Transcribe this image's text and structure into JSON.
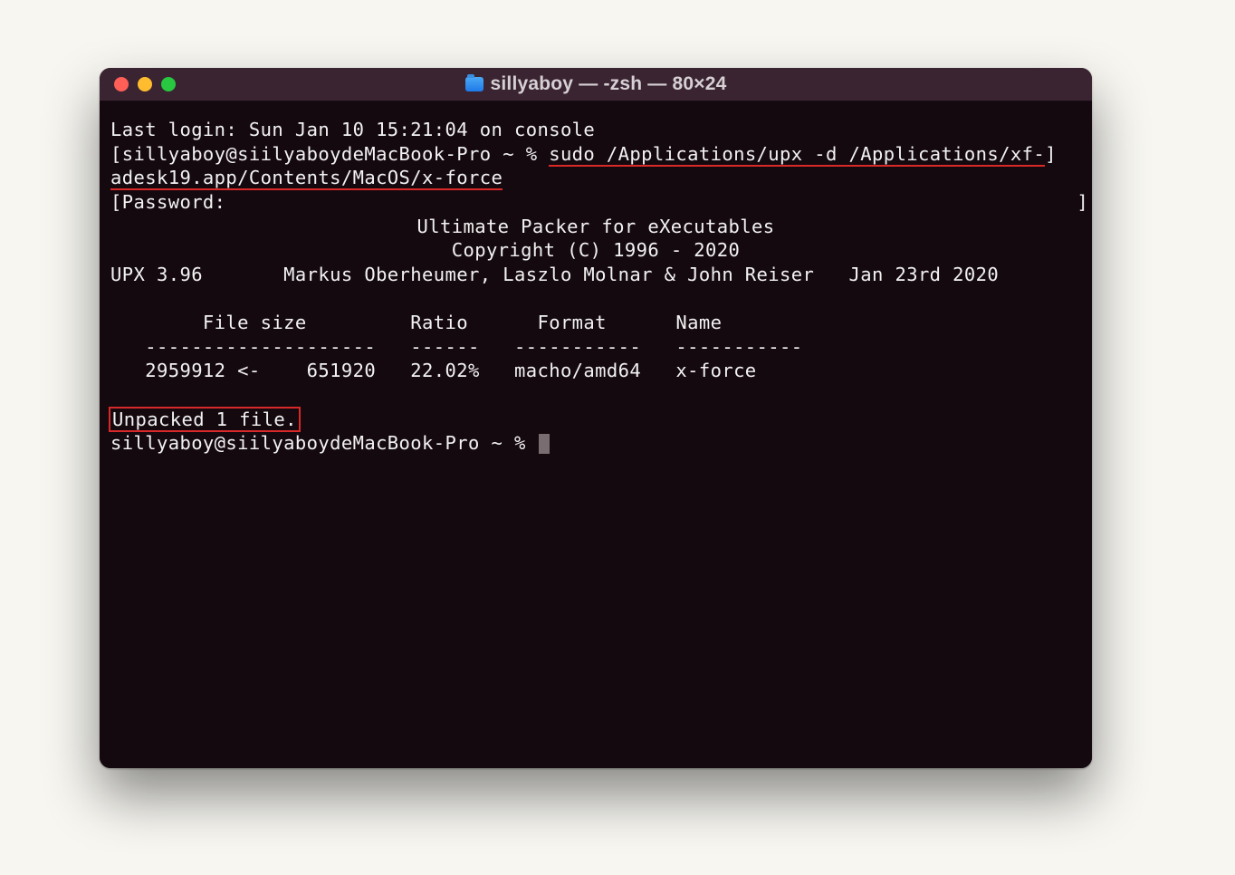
{
  "window": {
    "title": "sillyaboy — -zsh — 80×24"
  },
  "term": {
    "last_login": "Last login: Sun Jan 10 15:21:04 on console",
    "prompt1_prefix": "[sillyaboy@siilyaboydeMacBook-Pro ~ % ",
    "cmd_line1": "sudo /Applications/upx -d /Applications/xf-",
    "prompt1_suffix": "]",
    "cmd_line2": "adesk19.app/Contents/MacOS/x-force",
    "password_prefix": "[Password:",
    "password_suffix": "]",
    "upx_title": "Ultimate Packer for eXecutables",
    "upx_copyright": "Copyright (C) 1996 - 2020",
    "upx_ver_line": "UPX 3.96       Markus Oberheumer, Laszlo Molnar & John Reiser   Jan 23rd 2020",
    "tbl_head": "        File size         Ratio      Format      Name",
    "tbl_rule": "   --------------------   ------   -----------   -----------",
    "tbl_row": "   2959912 <-    651920   22.02%   macho/amd64   x-force",
    "unpacked": "Unpacked 1 file.",
    "prompt2": "sillyaboy@siilyaboydeMacBook-Pro ~ % "
  }
}
